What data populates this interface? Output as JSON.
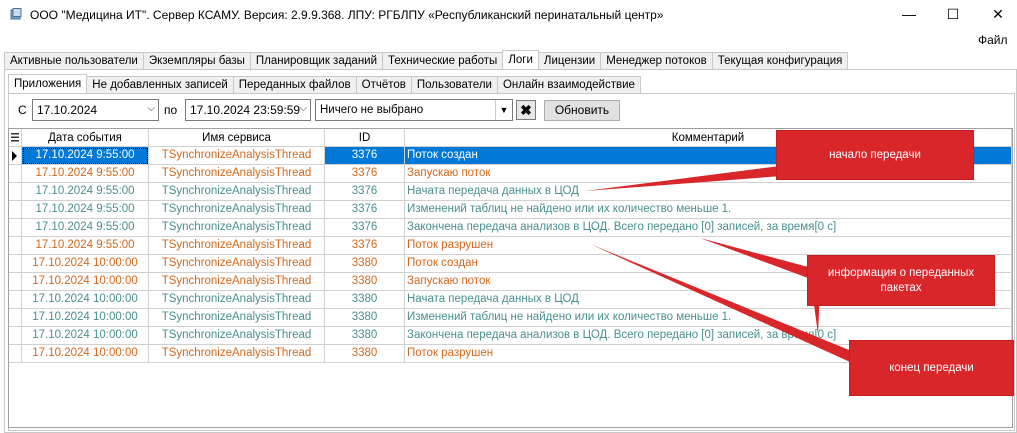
{
  "window": {
    "title": "ООО \"Медицина ИТ\". Сервер КСАМУ. Версия: 2.9.9.368. ЛПУ: РГБЛПУ «Республиканский перинатальный центр»",
    "minimize_glyph": "—",
    "maximize_glyph": "☐",
    "close_glyph": "✕",
    "menu_file": "Файл"
  },
  "outer_tabs": [
    {
      "label": "Активные пользователи",
      "active": false
    },
    {
      "label": "Экземпляры базы",
      "active": false
    },
    {
      "label": "Планировщик заданий",
      "active": false
    },
    {
      "label": "Технические работы",
      "active": false
    },
    {
      "label": "Логи",
      "active": true
    },
    {
      "label": "Лицензии",
      "active": false
    },
    {
      "label": "Менеджер потоков",
      "active": false
    },
    {
      "label": "Текущая конфигурация",
      "active": false
    }
  ],
  "inner_tabs": [
    {
      "label": "Приложения",
      "active": true
    },
    {
      "label": "Не добавленных записей",
      "active": false
    },
    {
      "label": "Переданных файлов",
      "active": false
    },
    {
      "label": "Отчётов",
      "active": false
    },
    {
      "label": "Пользователи",
      "active": false
    },
    {
      "label": "Онлайн взаимодействие",
      "active": false
    }
  ],
  "filter": {
    "from_label": "С",
    "from_value": "17.10.2024",
    "to_label": "по",
    "to_value": "17.10.2024 23:59:59",
    "service_value": "Ничего не выбрано",
    "clear_glyph": "✖",
    "refresh_label": "Обновить"
  },
  "grid": {
    "columns": [
      "Дата события",
      "Имя сервиса",
      "ID",
      "Комментарий"
    ],
    "rows": [
      {
        "date": "17.10.2024 9:55:00",
        "service": "TSynchronizeAnalysisThread",
        "id": "3376",
        "comment": "Поток создан",
        "color": "orange",
        "selected": true
      },
      {
        "date": "17.10.2024 9:55:00",
        "service": "TSynchronizeAnalysisThread",
        "id": "3376",
        "comment": "Запускаю поток",
        "color": "orange",
        "selected": false
      },
      {
        "date": "17.10.2024 9:55:00",
        "service": "TSynchronizeAnalysisThread",
        "id": "3376",
        "comment": "Начата передача данных в ЦОД",
        "color": "teal",
        "selected": false
      },
      {
        "date": "17.10.2024 9:55:00",
        "service": "TSynchronizeAnalysisThread",
        "id": "3376",
        "comment": "Изменений таблиц не найдено или их количество меньше 1.",
        "color": "teal",
        "selected": false
      },
      {
        "date": "17.10.2024 9:55:00",
        "service": "TSynchronizeAnalysisThread",
        "id": "3376",
        "comment": "Закончена передача анализов в ЦОД. Всего передано [0] записей, за время[0 с]",
        "color": "teal",
        "selected": false
      },
      {
        "date": "17.10.2024 9:55:00",
        "service": "TSynchronizeAnalysisThread",
        "id": "3376",
        "comment": "Поток разрушен",
        "color": "orange",
        "selected": false
      },
      {
        "date": "17.10.2024 10:00:00",
        "service": "TSynchronizeAnalysisThread",
        "id": "3380",
        "comment": "Поток создан",
        "color": "orange",
        "selected": false
      },
      {
        "date": "17.10.2024 10:00:00",
        "service": "TSynchronizeAnalysisThread",
        "id": "3380",
        "comment": "Запускаю поток",
        "color": "orange",
        "selected": false
      },
      {
        "date": "17.10.2024 10:00:00",
        "service": "TSynchronizeAnalysisThread",
        "id": "3380",
        "comment": "Начата передача данных в ЦОД",
        "color": "teal",
        "selected": false
      },
      {
        "date": "17.10.2024 10:00:00",
        "service": "TSynchronizeAnalysisThread",
        "id": "3380",
        "comment": "Изменений таблиц не найдено или их количество меньше 1.",
        "color": "teal",
        "selected": false
      },
      {
        "date": "17.10.2024 10:00:00",
        "service": "TSynchronizeAnalysisThread",
        "id": "3380",
        "comment": "Закончена передача анализов в ЦОД. Всего передано [0] записей, за время[0 с]",
        "color": "teal",
        "selected": false
      },
      {
        "date": "17.10.2024 10:00:00",
        "service": "TSynchronizeAnalysisThread",
        "id": "3380",
        "comment": "Поток разрушен",
        "color": "orange",
        "selected": false
      }
    ]
  },
  "annotations": {
    "start": "начало передачи",
    "packets": "информация о переданных пакетах",
    "end": "конец передачи",
    "color": "#d9262b"
  },
  "colors": {
    "orange_text": "#d2691e",
    "teal_text": "#4a8f8f",
    "selection": "#0078d7"
  },
  "icons": {
    "app": "app-icon",
    "row_pointer": "row-pointer-icon",
    "column_chooser": "column-chooser-icon"
  }
}
